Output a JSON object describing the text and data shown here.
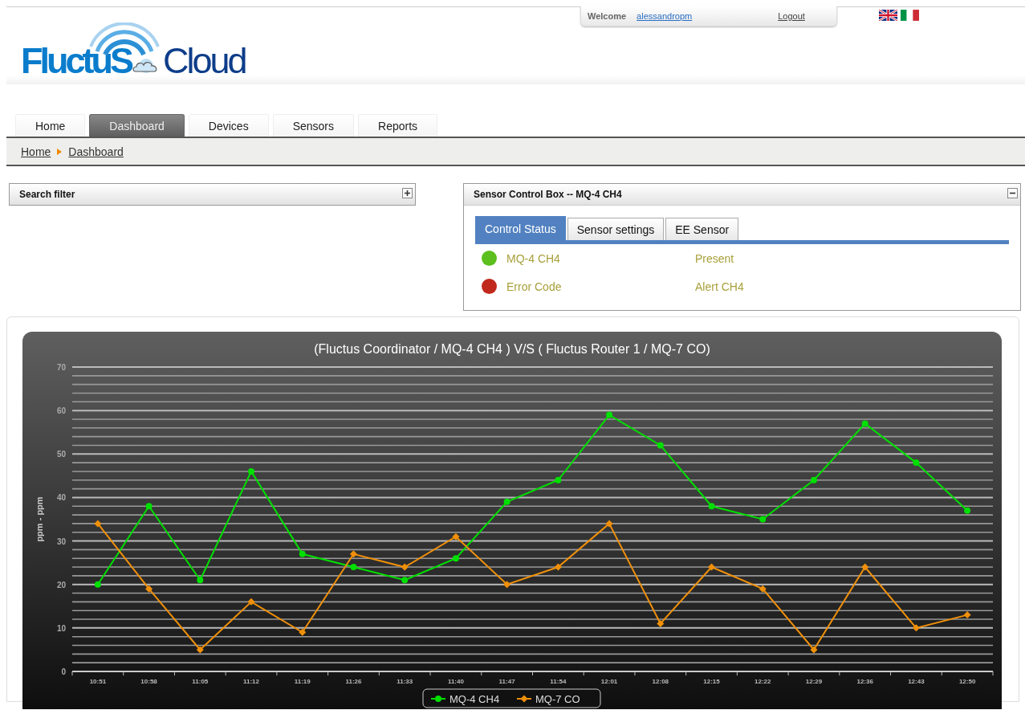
{
  "header": {
    "logo": {
      "part_1": "FluctuS",
      "part_2": "Cloud"
    },
    "welcome_label": "Welcome",
    "username": "alessandropm",
    "logout": "Logout",
    "languages": [
      {
        "kind": "en"
      },
      {
        "kind": "it"
      }
    ]
  },
  "nav_tabs": [
    {
      "label": "Home",
      "selected": false
    },
    {
      "label": "Dashboard",
      "selected": true
    },
    {
      "label": "Devices",
      "selected": false
    },
    {
      "label": "Sensors",
      "selected": false
    },
    {
      "label": "Reports",
      "selected": false
    }
  ],
  "breadcrumb": [
    "Home",
    "Dashboard"
  ],
  "search_filter": {
    "title": "Search filter",
    "expanded": false
  },
  "sensor_box": {
    "title": "Sensor Control Box -- MQ-4 CH4",
    "expanded": true,
    "tabs": [
      {
        "label": "Control Status",
        "selected": true
      },
      {
        "label": "Sensor settings",
        "selected": false
      },
      {
        "label": "EE Sensor",
        "selected": false
      }
    ],
    "rows": [
      {
        "label": "MQ-4 CH4",
        "value": "Present",
        "color": "#5cbf1e"
      },
      {
        "label": "Error Code",
        "value": "Alert CH4",
        "color": "#c0281c"
      }
    ]
  },
  "chart": {
    "chart_data": {
      "type": "line",
      "title": "(Fluctus Coordinator / MQ-4 CH4 ) V/S ( Fluctus Router 1 / MQ-7 CO)",
      "ylabel": "ppm - ppm",
      "categories": [
        "10:51",
        "10:58",
        "11:05",
        "11:12",
        "11:19",
        "11:26",
        "11:33",
        "11:40",
        "11:47",
        "11:54",
        "12:01",
        "12:08",
        "12:15",
        "12:22",
        "12:29",
        "12:36",
        "12:43",
        "12:50"
      ],
      "grid": true,
      "legend": true,
      "series": [
        {
          "name": "MQ-4 CH4",
          "color": "#00e000",
          "marker": "circle",
          "values": [
            20,
            38,
            21,
            46,
            27,
            24,
            21,
            26,
            39,
            44,
            59,
            52,
            38,
            35,
            44,
            57,
            48,
            37
          ]
        },
        {
          "name": "MQ-7 CO",
          "color": "#f0900a",
          "marker": "diamond",
          "values": [
            34,
            19,
            5,
            16,
            9,
            27,
            24,
            31,
            20,
            24,
            34,
            11,
            24,
            19,
            5,
            24,
            10,
            13
          ]
        }
      ],
      "ylim": [
        0,
        70
      ],
      "yticks": [
        0,
        10,
        20,
        30,
        40,
        50,
        60,
        70
      ]
    }
  }
}
